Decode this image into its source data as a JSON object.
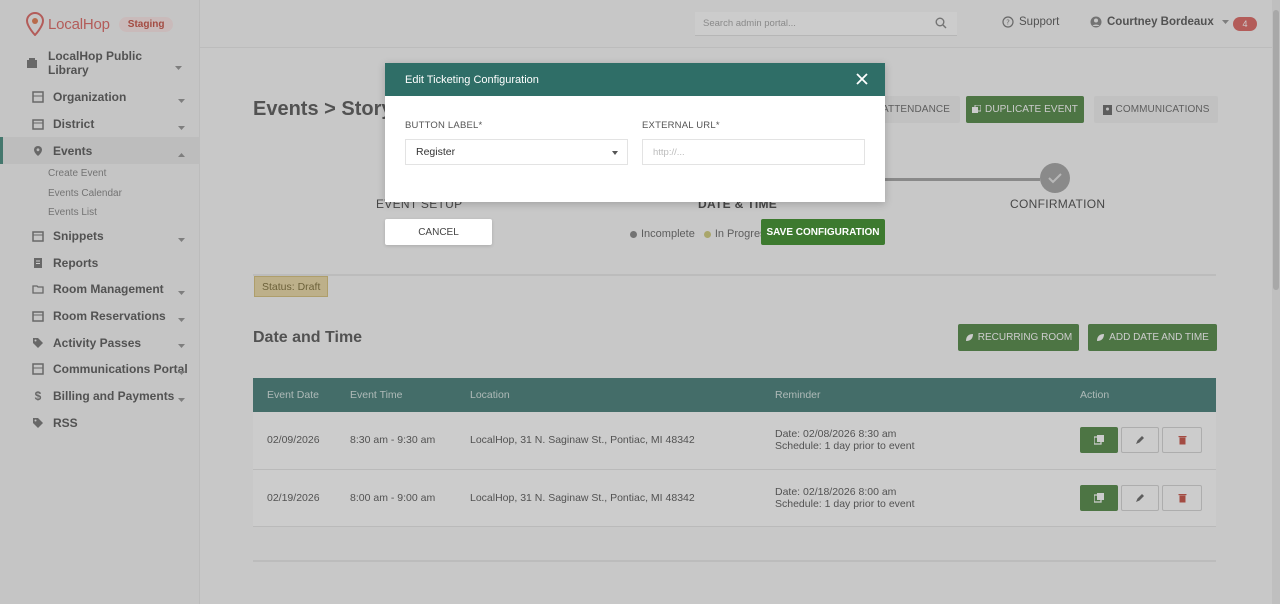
{
  "header": {
    "brand": "LocalHop",
    "env_badge": "Staging",
    "search_placeholder": "Search admin portal...",
    "support_label": "Support",
    "user_name": "Courtney Bordeaux",
    "notification_count": "4"
  },
  "sidebar": {
    "org_name": "LocalHop Public Library",
    "items": [
      {
        "label": "Organization",
        "icon": "grid-icon"
      },
      {
        "label": "District",
        "icon": "calendar-icon"
      },
      {
        "label": "Events",
        "icon": "pin-icon"
      },
      {
        "label": "Snippets",
        "icon": "calendar-icon"
      },
      {
        "label": "Reports",
        "icon": "doc-icon"
      },
      {
        "label": "Room Management",
        "icon": "folder-icon"
      },
      {
        "label": "Room Reservations",
        "icon": "calendar-icon"
      },
      {
        "label": "Activity Passes",
        "icon": "tag-icon"
      },
      {
        "label": "Communications Portal",
        "icon": "grid-icon"
      },
      {
        "label": "Billing and Payments",
        "icon": "dollar-icon"
      },
      {
        "label": "RSS",
        "icon": "tag-icon"
      }
    ],
    "events_sub": [
      "Create Event",
      "Events Calendar",
      "Events List"
    ]
  },
  "page": {
    "title": "Events > Storyt",
    "btn_attendance": "ATTENDANCE",
    "btn_duplicate": "DUPLICATE EVENT",
    "btn_communications": "COMMUNICATIONS",
    "step_event_setup": "EVENT SETUP",
    "step_date_time": "DATE & TIME",
    "step_confirmation": "CONFIRMATION",
    "legend_incomplete": "Incomplete",
    "legend_in_progress": "In Progres",
    "status": "Status: Draft",
    "section_title": "Date and Time",
    "btn_recurring_room": "RECURRING ROOM",
    "btn_add_date_time": "ADD DATE AND TIME"
  },
  "table": {
    "headers": [
      "Event Date",
      "Event Time",
      "Location",
      "Reminder",
      "Action"
    ],
    "rows": [
      {
        "date": "02/09/2026",
        "time": "8:30 am - 9:30 am",
        "location": "LocalHop, 31 N. Saginaw St., Pontiac, MI 48342",
        "reminder_date": "Date: 02/08/2026 8:30 am",
        "reminder_schedule": "Schedule: 1 day prior to event"
      },
      {
        "date": "02/19/2026",
        "time": "8:00 am - 9:00 am",
        "location": "LocalHop, 31 N. Saginaw St., Pontiac, MI 48342",
        "reminder_date": "Date: 02/18/2026 8:00 am",
        "reminder_schedule": "Schedule: 1 day prior to event"
      }
    ]
  },
  "modal": {
    "title": "Edit Ticketing Configuration",
    "button_label_label": "BUTTON LABEL*",
    "button_label_value": "Register",
    "external_url_label": "EXTERNAL URL*",
    "external_url_placeholder": "http://...",
    "cancel": "CANCEL",
    "save": "SAVE CONFIGURATION"
  },
  "colors": {
    "teal": "#2f6e67",
    "green": "#3d7a2f",
    "brand_red": "#d9534f"
  }
}
